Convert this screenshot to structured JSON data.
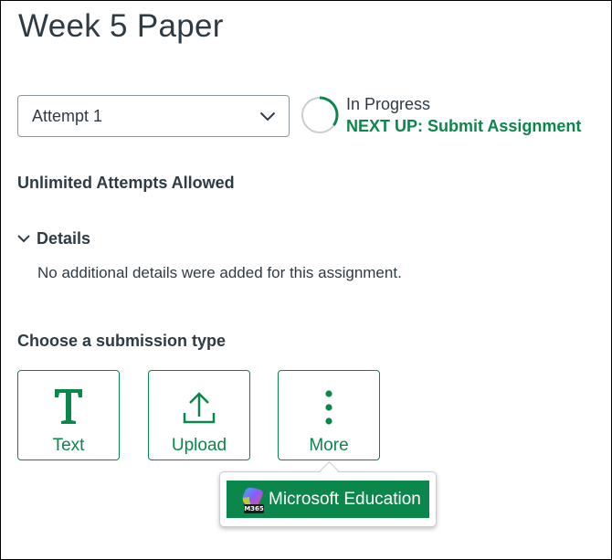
{
  "page": {
    "title": "Week 5 Paper"
  },
  "attempt": {
    "selected": "Attempt 1"
  },
  "status": {
    "state": "In Progress",
    "next_up": "NEXT UP: Submit Assignment",
    "ring_progress": 0.35
  },
  "attempts_allowed": "Unlimited Attempts Allowed",
  "details": {
    "label": "Details",
    "body": "No additional details were added for this assignment."
  },
  "submission": {
    "title": "Choose a submission type",
    "types": [
      {
        "label": "Text",
        "icon": "text-T-icon"
      },
      {
        "label": "Upload",
        "icon": "upload-icon"
      },
      {
        "label": "More",
        "icon": "vertical-ellipsis-icon"
      }
    ]
  },
  "more_menu": {
    "option_label": "Microsoft Education",
    "badge": "M365",
    "icon": "m365-logo-icon"
  },
  "colors": {
    "accent_green": "#0b874b",
    "text": "#2d3b45",
    "border": "#8d959f"
  }
}
